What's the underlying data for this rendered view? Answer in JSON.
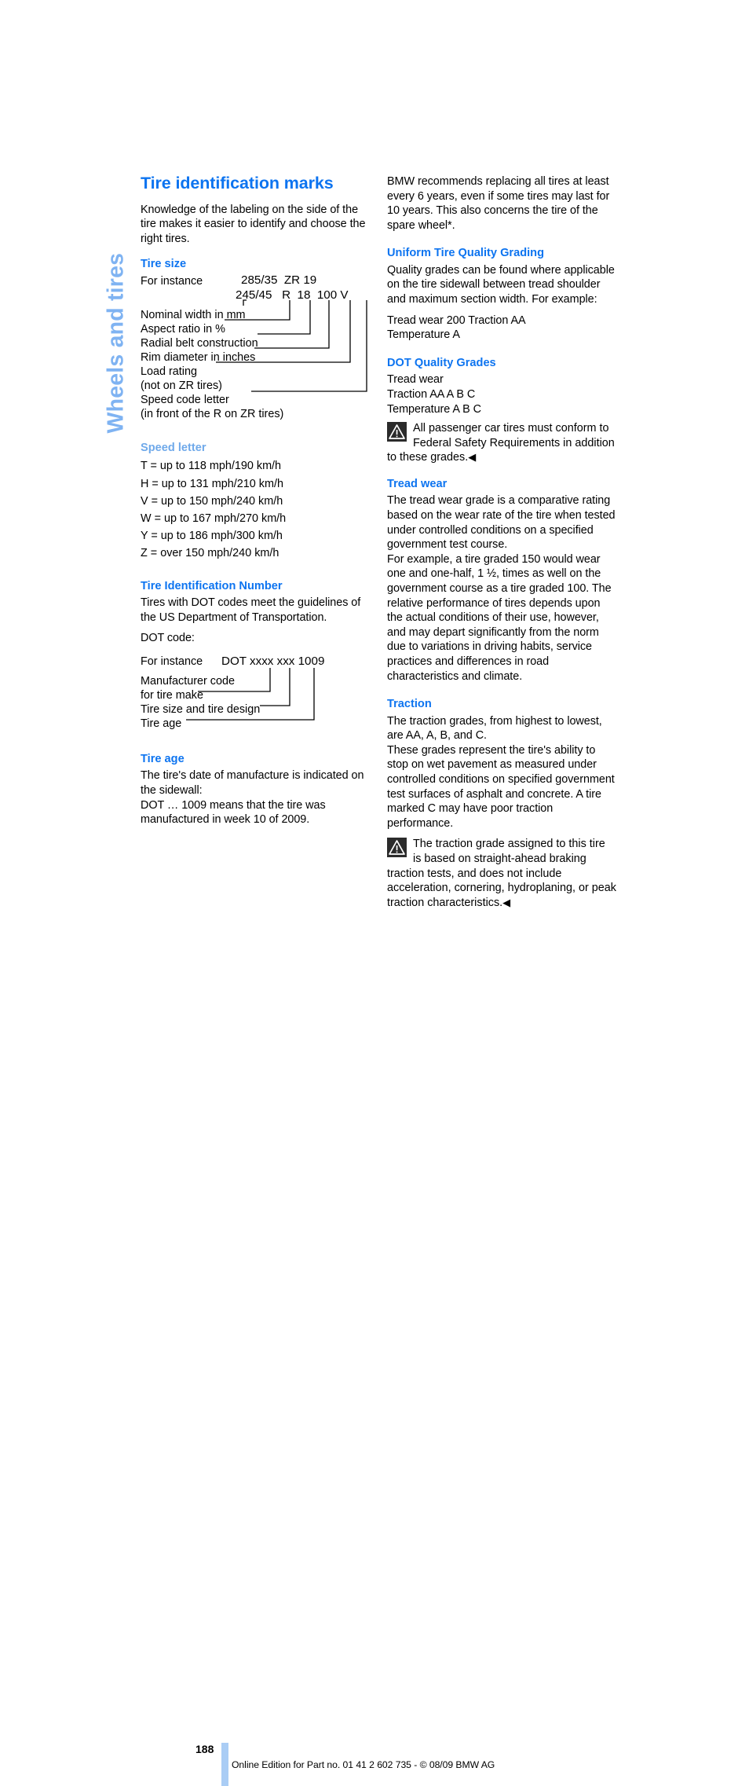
{
  "chapter_tab": "Wheels and tires",
  "left_column": {
    "title": "Tire identification marks",
    "intro": "Knowledge of the labeling on the side of the tire makes it easier to identify and choose the right tires.",
    "tire_size": {
      "heading": "Tire size",
      "for_instance": "For instance",
      "code_line1": "285/35  ZR 19",
      "code_line2": "245/45   R  18  100 V",
      "labels": [
        "Nominal width in mm",
        "Aspect ratio in %",
        "Radial belt construction",
        "Rim diameter in inches",
        "Load rating",
        "(not on ZR tires)",
        "Speed code letter",
        "(in front of the R on ZR tires)"
      ]
    },
    "speed_letter": {
      "heading": "Speed letter",
      "entries": [
        "T = up to 118 mph/190 km/h",
        "H = up to 131 mph/210 km/h",
        "V = up to 150 mph/240 km/h",
        "W = up to 167 mph/270 km/h",
        "Y = up to 186 mph/300 km/h",
        "Z = over 150 mph/240 km/h"
      ]
    },
    "tin": {
      "heading": "Tire Identification Number",
      "para": "Tires with DOT codes meet the guidelines of the US Department of Transportation.",
      "dot_code_label": "DOT code:",
      "for_instance": "For instance",
      "code": "DOT xxxx xxx 1009",
      "labels": [
        "Manufacturer code",
        "for tire make",
        "Tire size and tire design",
        "Tire age"
      ]
    },
    "tire_age": {
      "heading": "Tire age",
      "para1": "The tire's date of manufacture is indicated on the sidewall:",
      "para2": "DOT … 1009 means that the tire was manufactured in week 10 of 2009."
    }
  },
  "right_column": {
    "intro": "BMW recommends replacing all tires at least every 6 years, even if some tires may last for 10 years. This also concerns the tire of the spare wheel*.",
    "utqg": {
      "heading": "Uniform Tire Quality Grading",
      "para": "Quality grades can be found where applicable on the tire sidewall between tread shoulder and maximum section width. For example:",
      "example_line1": "Tread wear 200 Traction AA",
      "example_line2": "Temperature A"
    },
    "dot_grades": {
      "heading": "DOT Quality Grades",
      "lines": [
        "Tread wear",
        "Traction AA A B C",
        "Temperature A B C"
      ],
      "warning": "All passenger car tires must conform to Federal Safety Requirements in addition to these grades.",
      "warning_end": "◀"
    },
    "tread_wear": {
      "heading": "Tread wear",
      "para1": "The tread wear grade is a comparative rating based on the wear rate of the tire when tested under controlled conditions on a specified government test course.",
      "para2": "For example, a tire graded 150 would wear one and one-half, 1 ½, times as well on the government course as a tire graded 100. The relative performance of tires depends upon the actual conditions of their use, however, and may depart significantly from the norm due to variations in driving habits, service practices and differences in road characteristics and climate."
    },
    "traction": {
      "heading": "Traction",
      "para1": "The traction grades, from highest to lowest, are AA, A, B, and C.",
      "para2": "These grades represent the tire's ability to stop on wet pavement as measured under controlled conditions on specified government test surfaces of asphalt and concrete. A tire marked C may have poor traction performance.",
      "warning": "The traction grade assigned to this tire is based on straight-ahead braking traction tests, and does not include acceleration, cornering, hydroplaning, or peak traction characteristics.",
      "warning_end": "◀"
    }
  },
  "footer": {
    "page_number": "188",
    "edition_text": "Online Edition for Part no. 01 41 2 602 735 - © 08/09 BMW AG"
  },
  "colors": {
    "heading_blue": "#0d74f0",
    "pale_blue": "#6fa9ea",
    "tab_blue": "#7fb3f2",
    "footer_bar": "#aacdf5",
    "warning_icon_bg": "#2b2b2b"
  }
}
